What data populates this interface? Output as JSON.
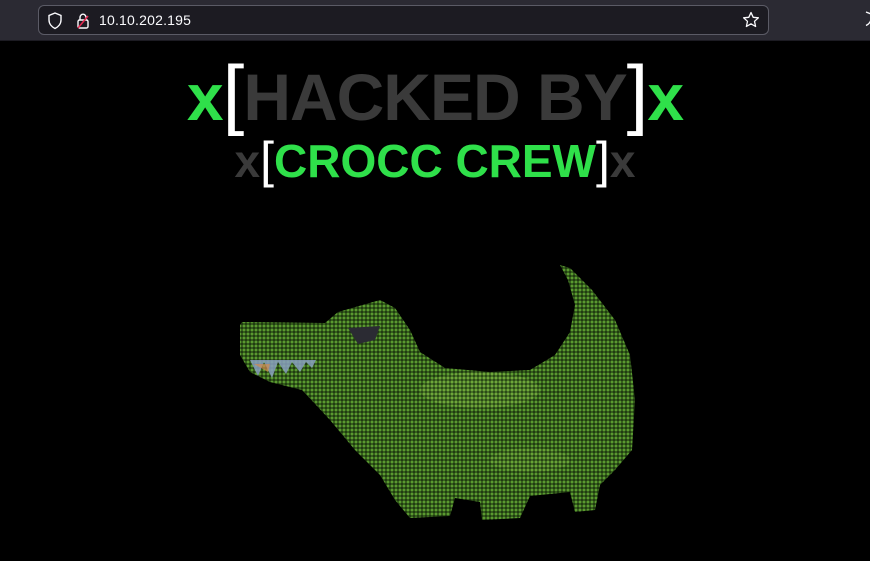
{
  "browser": {
    "url": "10.10.202.195",
    "icons": [
      "shield-icon",
      "lock-icon",
      "star-icon"
    ]
  },
  "page": {
    "line1": {
      "x_left": "x",
      "bracket_open": "[",
      "text": "HACKED BY",
      "bracket_close": "]",
      "x_right": "x"
    },
    "line2": {
      "x_left": "x",
      "bracket_open": "[",
      "text": "CROCC CREW",
      "bracket_close": "]",
      "x_right": "x"
    },
    "image": {
      "icon": "crocodile-image"
    }
  },
  "colors": {
    "accent_green": "#2fe04a",
    "dim_gray": "#3a3a3a",
    "croc_green": "#4e8a2a"
  }
}
